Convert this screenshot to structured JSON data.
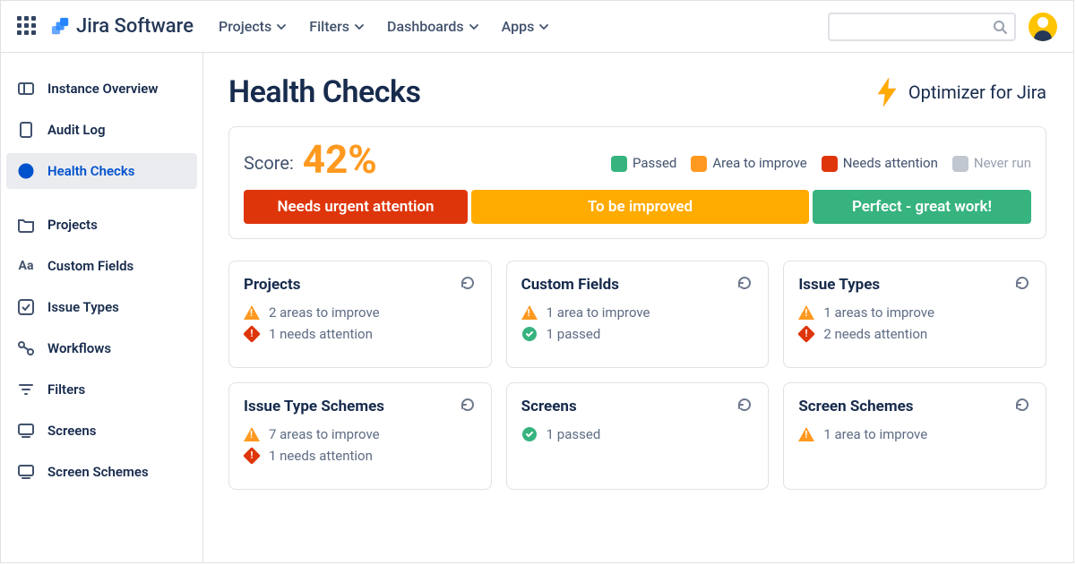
{
  "nav": {
    "brand": "Jira Software",
    "items": [
      "Projects",
      "Filters",
      "Dashboards",
      "Apps"
    ]
  },
  "sidebar": {
    "items": [
      {
        "label": "Instance Overview"
      },
      {
        "label": "Audit Log"
      },
      {
        "label": "Health Checks"
      },
      {
        "label": "Projects"
      },
      {
        "label": "Custom Fields"
      },
      {
        "label": "Issue Types"
      },
      {
        "label": "Workflows"
      },
      {
        "label": "Filters"
      },
      {
        "label": "Screens"
      },
      {
        "label": "Screen Schemes"
      }
    ]
  },
  "page": {
    "title": "Health Checks",
    "optimizer": "Optimizer for Jira"
  },
  "score": {
    "label": "Score:",
    "value": "42%",
    "legend": {
      "passed": "Passed",
      "improve": "Area to improve",
      "attention": "Needs attention",
      "never": "Never run"
    },
    "bars": {
      "red": "Needs urgent attention",
      "orange": "To be improved",
      "green": "Perfect - great work!"
    }
  },
  "cards": [
    {
      "title": "Projects",
      "improve": "2 areas to improve",
      "attention": "1 needs attention"
    },
    {
      "title": "Custom Fields",
      "improve": "1 area to improve",
      "passed": "1 passed"
    },
    {
      "title": "Issue Types",
      "improve": "1 areas to improve",
      "attention": "2 needs attention"
    },
    {
      "title": "Issue Type Schemes",
      "improve": "7 areas to improve",
      "attention": "1 needs attention"
    },
    {
      "title": "Screens",
      "passed": "1 passed"
    },
    {
      "title": "Screen Schemes",
      "improve": "1 area to improve"
    }
  ]
}
